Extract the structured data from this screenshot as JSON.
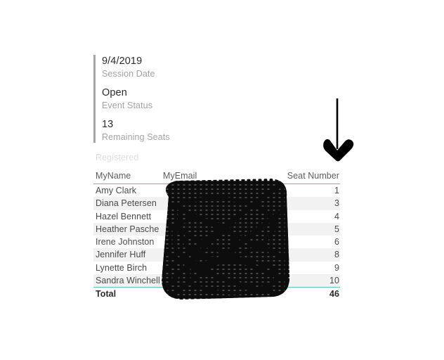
{
  "kpi_cards": {
    "accent_color": "#a6a6a6",
    "items": [
      {
        "value": "9/4/2019",
        "label": "Session Date"
      },
      {
        "value": "Open",
        "label": "Event Status"
      },
      {
        "value": "13",
        "label": "Remaining Seats"
      }
    ]
  },
  "table": {
    "caption": "Registered",
    "accent_color": "#58c6bf",
    "stripe_color": "#f2f2f2",
    "columns": [
      {
        "key": "name",
        "label": "MyName"
      },
      {
        "key": "email",
        "label": "MyEmail"
      },
      {
        "key": "seat",
        "label": "Seat Number"
      }
    ],
    "rows": [
      {
        "name": "Amy Clark",
        "email": "",
        "seat": "1"
      },
      {
        "name": "Diana Petersen",
        "email": "",
        "seat": "3"
      },
      {
        "name": "Hazel Bennett",
        "email": "",
        "seat": "4"
      },
      {
        "name": "Heather Pasche",
        "email": "",
        "seat": "5"
      },
      {
        "name": "Irene Johnston",
        "email": "",
        "seat": "6"
      },
      {
        "name": "Jennifer Huff",
        "email": "",
        "seat": "8"
      },
      {
        "name": "Lynette Birch",
        "email": "",
        "seat": "9"
      },
      {
        "name": "Sandra Winchell",
        "email": "",
        "seat": "10"
      }
    ],
    "total": {
      "label": "Total",
      "email": "",
      "seat": "46"
    }
  },
  "annotations": {
    "arrow": {
      "icon": "down-arrow-icon",
      "color": "#000000",
      "direction": "down"
    },
    "redaction": {
      "icon": "scribble-redaction-icon",
      "color": "#0d0d0d"
    }
  }
}
